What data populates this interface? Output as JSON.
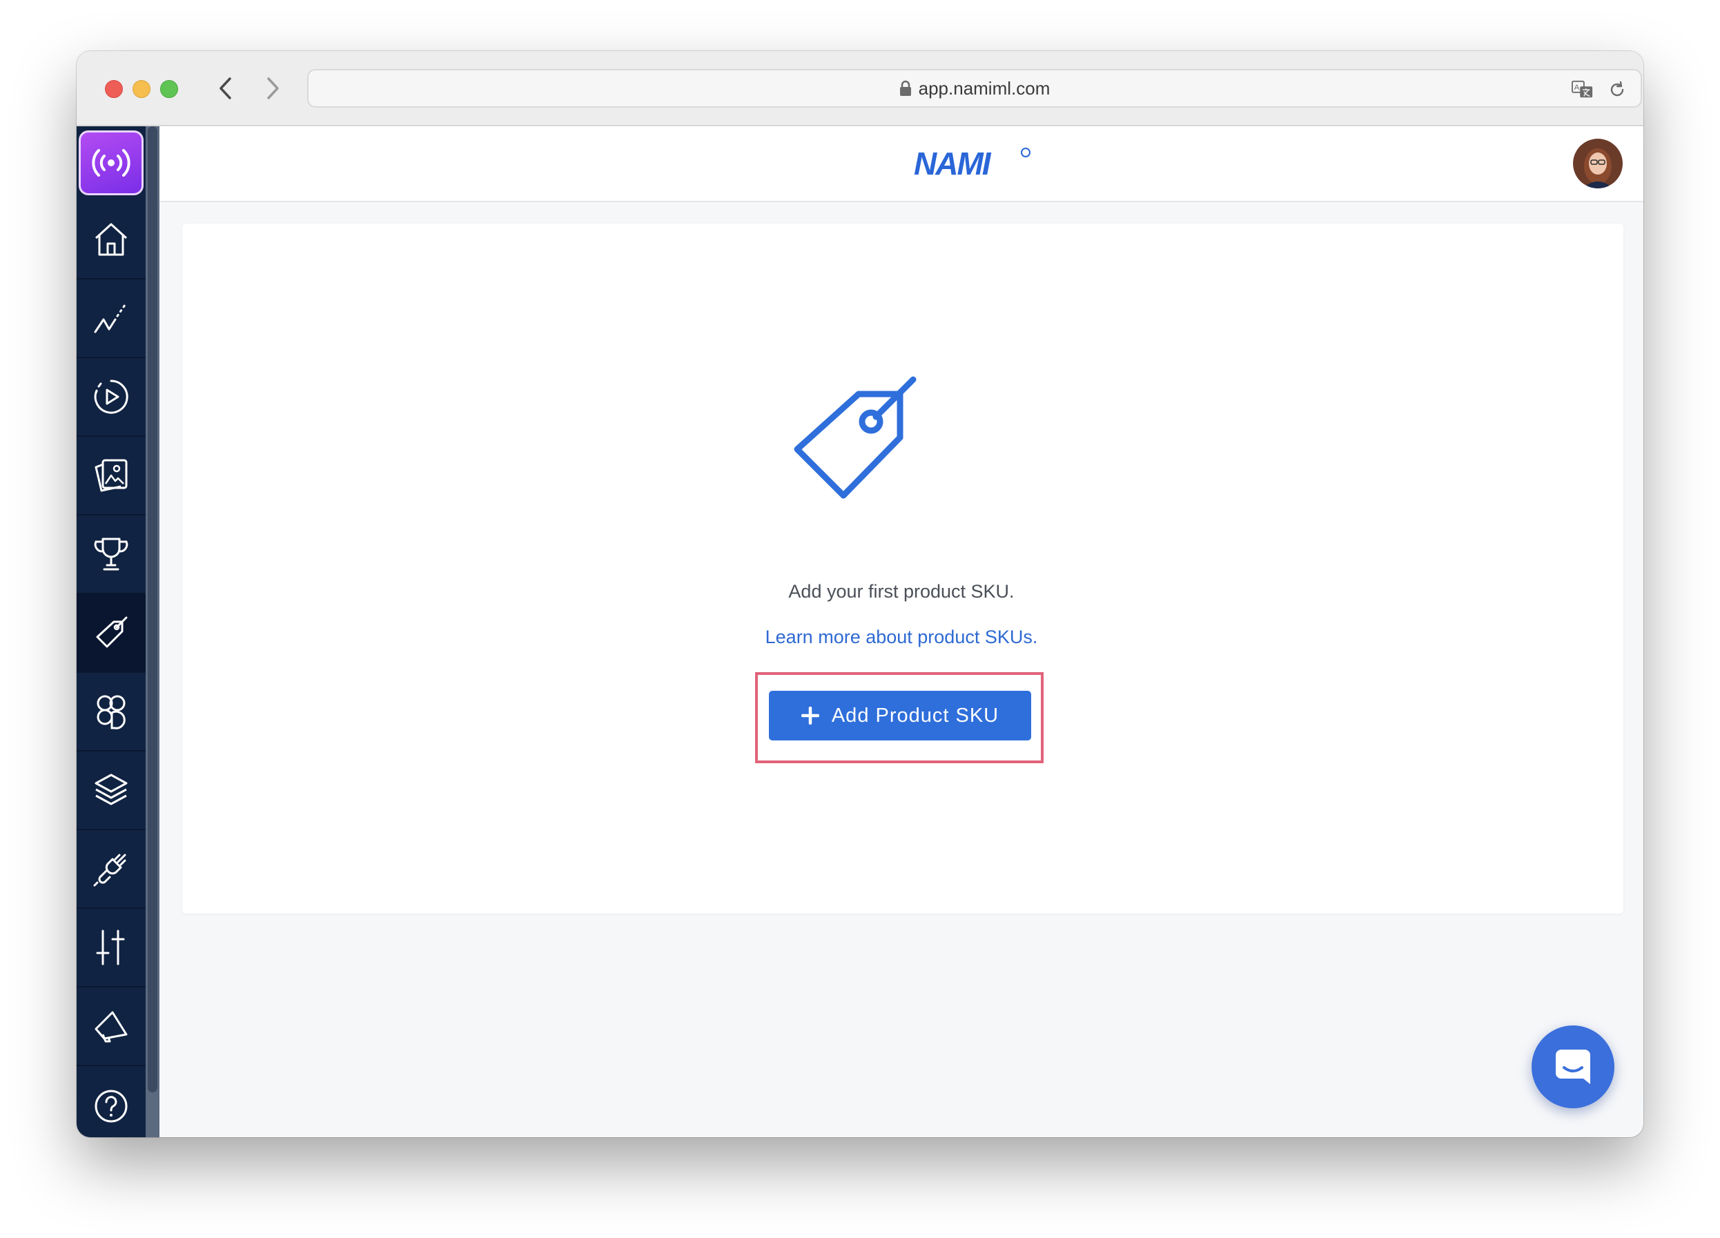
{
  "browser": {
    "url": "app.namiml.com"
  },
  "app": {
    "brand_name": "NAMI"
  },
  "sidebar": {
    "items": [
      {
        "icon": "home-icon"
      },
      {
        "icon": "analytics-icon"
      },
      {
        "icon": "play-icon"
      },
      {
        "icon": "paywall-images-icon"
      },
      {
        "icon": "trophy-icon"
      },
      {
        "icon": "tag-icon",
        "active": true
      },
      {
        "icon": "customers-icon"
      },
      {
        "icon": "layers-icon"
      },
      {
        "icon": "integrations-plug-icon"
      },
      {
        "icon": "settings-sliders-icon"
      },
      {
        "icon": "announcements-icon"
      },
      {
        "icon": "help-icon"
      }
    ]
  },
  "empty_state": {
    "message": "Add your first product SKU.",
    "link_text": "Learn more about product SKUs.",
    "button_label": "Add Product SKU"
  },
  "colors": {
    "sidebar_bg": "#112342",
    "accent_blue": "#2f6fdb",
    "brand_purple": "#9b3ff0",
    "highlight": "#e0637a"
  }
}
